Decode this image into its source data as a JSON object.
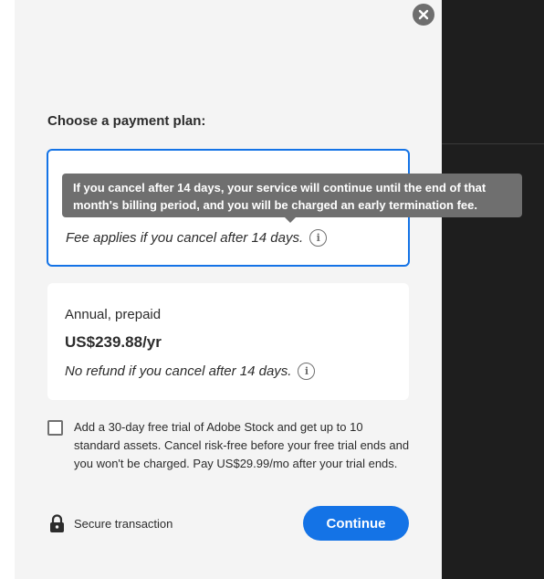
{
  "modal": {
    "heading": "Choose a payment plan:",
    "close_icon": "close-icon"
  },
  "plans": [
    {
      "name": "",
      "price": "",
      "note": "Fee applies if you cancel after 14 days.",
      "selected": true,
      "tooltip": "If you cancel after 14 days, your service will continue until the end of that month's billing period, and you will be charged an early termination fee."
    },
    {
      "name": "Annual, prepaid",
      "price": "US$239.88/yr",
      "note": "No refund if you cancel after 14 days.",
      "selected": false
    }
  ],
  "stock_offer": {
    "checked": false,
    "text": "Add a 30-day free trial of Adobe Stock and get up to 10 standard assets. Cancel risk-free before your free trial ends and you won't be charged. Pay US$29.99/mo after your trial ends."
  },
  "footer": {
    "secure_label": "Secure transaction",
    "continue_label": "Continue",
    "lock_icon": "lock-icon"
  },
  "colors": {
    "accent": "#1473e6",
    "panel_bg": "#f4f4f4",
    "tooltip_bg": "#6f6f6f",
    "dark_bg": "#1e1e1e"
  }
}
